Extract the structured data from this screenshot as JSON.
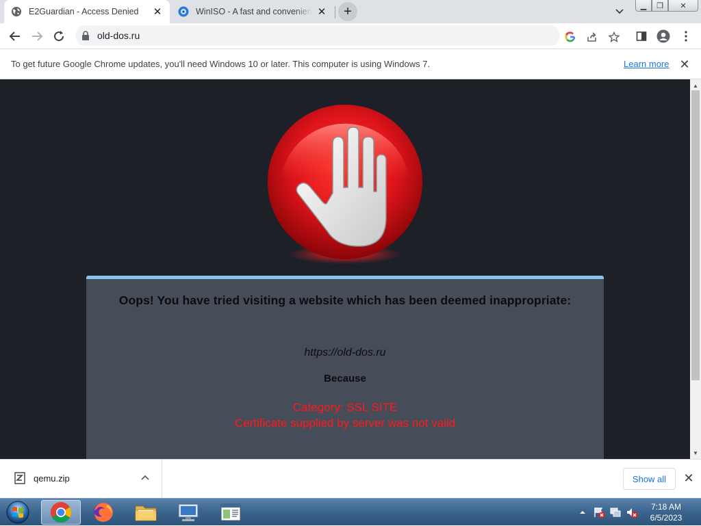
{
  "tabs": [
    {
      "title": "E2Guardian - Access Denied",
      "active": true,
      "favicon": "globe-icon"
    },
    {
      "title": "WinISO - A fast and convenient I",
      "active": false,
      "favicon": "winiso-icon"
    }
  ],
  "new_tab_symbol": "+",
  "toolbar": {
    "url": "old-dos.ru"
  },
  "infobar": {
    "message": "To get future Google Chrome updates, you'll need Windows 10 or later. This computer is using Windows 7.",
    "link": "Learn more"
  },
  "page": {
    "headline": "Oops! You have tried visiting a website which has been deemed inappropriate:",
    "blocked_url": "https://old-dos.ru",
    "because": "Because",
    "reason_category": "Category: SSL SITE",
    "reason_detail": "Certificate supplied by server was not valid"
  },
  "downloads": {
    "items": [
      {
        "filename": "qemu.zip"
      }
    ],
    "show_all": "Show all"
  },
  "taskbar": {
    "apps": [
      "chrome-icon",
      "firefox-icon",
      "explorer-icon",
      "remote-desktop-icon",
      "window-icon"
    ],
    "time": "7:18 AM",
    "date": "6/5/2023"
  },
  "colors": {
    "page_bg": "#1e2028",
    "panel_bg": "#474c59",
    "panel_accent": "#8bc4ea",
    "reason_red": "#ff1a1a",
    "link_blue": "#1a73e8"
  }
}
